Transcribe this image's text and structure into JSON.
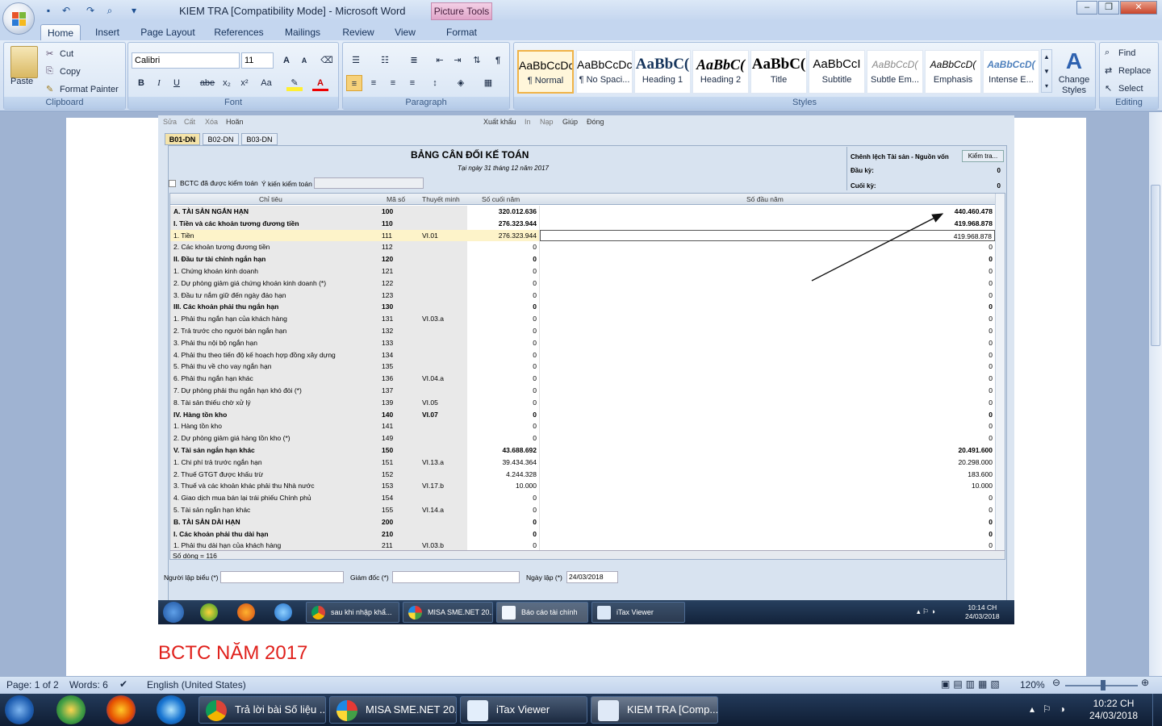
{
  "window": {
    "title": "KIEM TRA [Compatibility Mode] - Microsoft Word",
    "context_tab": "Picture Tools"
  },
  "tabs": [
    {
      "label": "Home",
      "active": true
    },
    {
      "label": "Insert"
    },
    {
      "label": "Page Layout"
    },
    {
      "label": "References"
    },
    {
      "label": "Mailings"
    },
    {
      "label": "Review"
    },
    {
      "label": "View"
    },
    {
      "label": "Format"
    }
  ],
  "clipboard": {
    "paste": "Paste",
    "cut": "Cut",
    "copy": "Copy",
    "format_painter": "Format Painter",
    "label": "Clipboard"
  },
  "font": {
    "name": "Calibri",
    "size": "11",
    "label": "Font",
    "bold": "B",
    "italic": "I",
    "underline": "U",
    "strike": "abe",
    "sub": "x₂",
    "sup": "x²",
    "case": "Aa",
    "color_a": "A"
  },
  "paragraph": {
    "label": "Paragraph"
  },
  "styles": {
    "label": "Styles",
    "items": [
      {
        "preview": "AaBbCcDc",
        "name": "¶ Normal"
      },
      {
        "preview": "AaBbCcDc",
        "name": "¶ No Spaci..."
      },
      {
        "preview": "AaBbC(",
        "name": "Heading 1"
      },
      {
        "preview": "AaBbC(",
        "name": "Heading 2"
      },
      {
        "preview": "AaBbC(",
        "name": "Title"
      },
      {
        "preview": "AaBbCcI",
        "name": "Subtitle"
      },
      {
        "preview": "AaBbCcD(",
        "name": "Subtle Em..."
      },
      {
        "preview": "AaBbCcD(",
        "name": "Emphasis"
      },
      {
        "preview": "AaBbCcD(",
        "name": "Intense E..."
      }
    ],
    "change": "Change Styles"
  },
  "editing": {
    "find": "Find",
    "replace": "Replace",
    "select": "Select",
    "label": "Editing"
  },
  "embedded": {
    "menu": [
      "Sửa",
      "Cất",
      "Xóa",
      "Hoãn",
      "Xuất khẩu",
      "In",
      "Nạp",
      "Giúp",
      "Đóng"
    ],
    "tabs": [
      "B01-DN",
      "B02-DN",
      "B03-DN"
    ],
    "title": "BẢNG CÂN ĐỐI KẾ TOÁN",
    "subtitle": "Tại ngày 31 tháng 12 năm 2017",
    "audited_checkbox": "BCTC đã được kiểm toán",
    "audit_opinion_label": "Ý kiến kiểm toán",
    "diff_panel": {
      "title": "Chênh lệch Tài sản - Nguồn vốn",
      "check_btn": "Kiểm tra...",
      "start_label": "Đầu kỳ:",
      "start_value": "0",
      "end_label": "Cuối kỳ:",
      "end_value": "0"
    },
    "columns": [
      "Chỉ tiêu",
      "Mã số",
      "Thuyết minh",
      "Số cuối năm",
      "Số đầu năm"
    ],
    "rows": [
      {
        "name": "A. TÀI SẢN NGẮN HẠN",
        "code": "100",
        "note": "",
        "end": "320.012.636",
        "start": "440.460.478",
        "bold": true
      },
      {
        "name": "I. Tiền và các khoản tương đương tiền",
        "code": "110",
        "note": "",
        "end": "276.323.944",
        "start": "419.968.878",
        "bold": true
      },
      {
        "name": "1. Tiền",
        "code": "111",
        "note": "VI.01",
        "end": "276.323.944",
        "start": "419.968.878",
        "hl": true
      },
      {
        "name": "2. Các khoản tương đương tiền",
        "code": "112",
        "note": "",
        "end": "0",
        "start": "0"
      },
      {
        "name": "II. Đầu tư tài chính ngắn hạn",
        "code": "120",
        "note": "",
        "end": "0",
        "start": "0",
        "bold": true
      },
      {
        "name": "1. Chứng khoán kinh doanh",
        "code": "121",
        "note": "",
        "end": "0",
        "start": "0"
      },
      {
        "name": "2. Dự phòng giảm giá chứng khoán kinh doanh (*)",
        "code": "122",
        "note": "",
        "end": "0",
        "start": "0"
      },
      {
        "name": "3. Đầu tư nắm giữ đến ngày đáo hạn",
        "code": "123",
        "note": "",
        "end": "0",
        "start": "0"
      },
      {
        "name": "III. Các khoản phải thu ngắn hạn",
        "code": "130",
        "note": "",
        "end": "0",
        "start": "0",
        "bold": true
      },
      {
        "name": "1. Phải thu ngắn hạn của khách hàng",
        "code": "131",
        "note": "VI.03.a",
        "end": "0",
        "start": "0"
      },
      {
        "name": "2. Trả trước cho người bán ngắn hạn",
        "code": "132",
        "note": "",
        "end": "0",
        "start": "0"
      },
      {
        "name": "3. Phải thu nội bộ ngắn hạn",
        "code": "133",
        "note": "",
        "end": "0",
        "start": "0"
      },
      {
        "name": "4. Phải thu theo tiến độ kế hoạch hợp đồng xây dựng",
        "code": "134",
        "note": "",
        "end": "0",
        "start": "0"
      },
      {
        "name": "5. Phải thu về cho vay ngắn hạn",
        "code": "135",
        "note": "",
        "end": "0",
        "start": "0"
      },
      {
        "name": "6. Phải thu ngắn hạn khác",
        "code": "136",
        "note": "VI.04.a",
        "end": "0",
        "start": "0"
      },
      {
        "name": "7. Dự phòng phải thu ngắn hạn khó đòi (*)",
        "code": "137",
        "note": "",
        "end": "0",
        "start": "0"
      },
      {
        "name": "8. Tài sản thiếu chờ xử lý",
        "code": "139",
        "note": "VI.05",
        "end": "0",
        "start": "0"
      },
      {
        "name": "IV. Hàng tồn kho",
        "code": "140",
        "note": "VI.07",
        "end": "0",
        "start": "0",
        "bold": true
      },
      {
        "name": "1. Hàng tồn kho",
        "code": "141",
        "note": "",
        "end": "0",
        "start": "0"
      },
      {
        "name": "2. Dự phòng giảm giá hàng tồn kho (*)",
        "code": "149",
        "note": "",
        "end": "0",
        "start": "0"
      },
      {
        "name": "V. Tài sản ngắn hạn khác",
        "code": "150",
        "note": "",
        "end": "43.688.692",
        "start": "20.491.600",
        "bold": true
      },
      {
        "name": "1. Chi phí trả trước ngắn hạn",
        "code": "151",
        "note": "VI.13.a",
        "end": "39.434.364",
        "start": "20.298.000"
      },
      {
        "name": "2. Thuế GTGT được khấu trừ",
        "code": "152",
        "note": "",
        "end": "4.244.328",
        "start": "183.600"
      },
      {
        "name": "3. Thuế và các khoản khác phải thu Nhà nước",
        "code": "153",
        "note": "VI.17.b",
        "end": "10.000",
        "start": "10.000"
      },
      {
        "name": "4. Giao dịch mua bán lại trái phiếu Chính phủ",
        "code": "154",
        "note": "",
        "end": "0",
        "start": "0"
      },
      {
        "name": "5. Tài sản ngắn hạn khác",
        "code": "155",
        "note": "VI.14.a",
        "end": "0",
        "start": "0"
      },
      {
        "name": "B. TÀI SẢN DÀI HẠN",
        "code": "200",
        "note": "",
        "end": "0",
        "start": "0",
        "bold": true
      },
      {
        "name": "I. Các khoản phải thu dài hạn",
        "code": "210",
        "note": "",
        "end": "0",
        "start": "0",
        "bold": true
      },
      {
        "name": "1. Phải thu dài hạn của khách hàng",
        "code": "211",
        "note": "VI.03.b",
        "end": "0",
        "start": "0"
      }
    ],
    "row_count": "Số dòng = 116",
    "footer": {
      "preparer": "Người lập biểu (*)",
      "director": "Giám đốc (*)",
      "date_label": "Ngày lập (*)",
      "date_value": "24/03/2018"
    },
    "taskbar": [
      {
        "label": "sau khi nhập khẩ..."
      },
      {
        "label": "MISA SME.NET 20..."
      },
      {
        "label": "Báo cáo tài chính"
      },
      {
        "label": "iTax Viewer"
      }
    ],
    "clock_time": "10:14 CH",
    "clock_date": "24/03/2018"
  },
  "caption": "BCTC NĂM 2017",
  "status": {
    "page": "Page: 1 of 2",
    "words": "Words: 6",
    "language": "English (United States)",
    "zoom": "120%"
  },
  "taskbar": {
    "items": [
      {
        "label": "Trả lời bài Số liệu ..."
      },
      {
        "label": "MISA SME.NET 20..."
      },
      {
        "label": "iTax Viewer"
      },
      {
        "label": "KIEM TRA [Comp..."
      }
    ],
    "time": "10:22 CH",
    "date": "24/03/2018"
  }
}
